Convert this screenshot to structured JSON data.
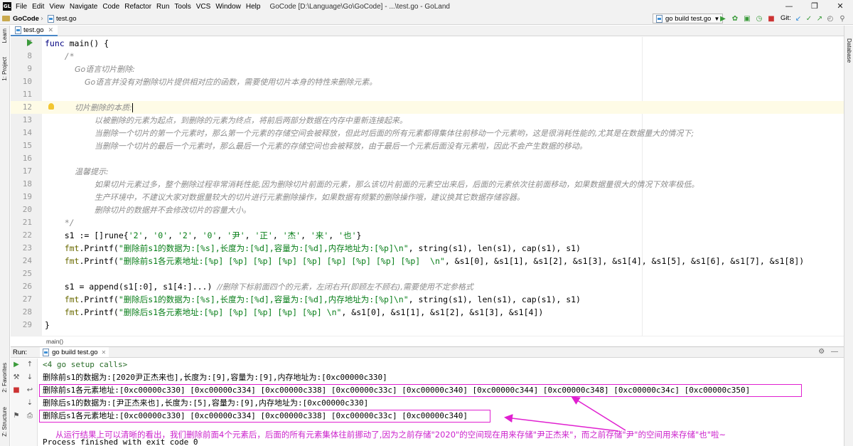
{
  "titlebar": {
    "menus": [
      "File",
      "Edit",
      "View",
      "Navigate",
      "Code",
      "Refactor",
      "Run",
      "Tools",
      "VCS",
      "Window",
      "Help"
    ],
    "window_title": "GoCode [D:\\Language\\Go\\GoCode] - ...\\test.go - GoLand",
    "logo": "GL"
  },
  "navbar": {
    "project": "GoCode",
    "file": "test.go",
    "run_config": "go build test.go",
    "git_label": "Git:"
  },
  "left_tabs": [
    "1: Project",
    "Learn",
    "2: Favorites",
    "Z: Structure"
  ],
  "right_tabs": [
    "Database"
  ],
  "editor": {
    "tab_label": "test.go",
    "lines": [
      {
        "n": "7",
        "segments": [
          {
            "t": "kw",
            "v": "func"
          },
          {
            "t": "plain",
            "v": " main() {"
          }
        ]
      },
      {
        "n": "8",
        "segments": [
          {
            "t": "cmt-mono",
            "v": "    /*"
          }
        ]
      },
      {
        "n": "9",
        "segments": [
          {
            "t": "comment",
            "v": "            Go语言切片删除:"
          }
        ]
      },
      {
        "n": "10",
        "segments": [
          {
            "t": "comment",
            "v": "                Go语言并没有对删除切片提供相对应的函数，需要使用切片本身的特性来删除元素。"
          }
        ]
      },
      {
        "n": "11",
        "segments": []
      },
      {
        "n": "12",
        "segments": [
          {
            "t": "comment",
            "v": "            切片删除的本质:"
          }
        ],
        "highlight": true,
        "caret": true
      },
      {
        "n": "13",
        "segments": [
          {
            "t": "comment",
            "v": "                    以被删除的元素为起点，到删除的元素为终点，将前后两部分数据在内存中重新连接起来。"
          }
        ]
      },
      {
        "n": "14",
        "segments": [
          {
            "t": "comment",
            "v": "                    当删除一个切片的第一个元素时，那么第一个元素的存储空间会被释放，但此时后面的所有元素都得集体往前移动一个元素哟，这是很消耗性能的,尤其是在数据量大的情况下;"
          }
        ]
      },
      {
        "n": "15",
        "segments": [
          {
            "t": "comment",
            "v": "                    当删除一个切片的最后一个元素时，那么最后一个元素的存储空间也会被释放，由于最后一个元素后面没有元素啦，因此不会产生数据的移动。"
          }
        ]
      },
      {
        "n": "16",
        "segments": []
      },
      {
        "n": "17",
        "segments": [
          {
            "t": "comment",
            "v": "            温馨提示:"
          }
        ]
      },
      {
        "n": "18",
        "segments": [
          {
            "t": "comment",
            "v": "                    如果切片元素过多，整个删除过程非常消耗性能,因为删除切片前面的元素，那么该切片前面的元素空出来后，后面的元素依次往前面移动，如果数据量很大的情况下效率极低。"
          }
        ]
      },
      {
        "n": "19",
        "segments": [
          {
            "t": "comment",
            "v": "                    生产环境中，不建议大家对数据量较大的切片进行元素删除操作，如果数据有频繁的删除操作哦，建议换其它数据存储容器。"
          }
        ]
      },
      {
        "n": "20",
        "segments": [
          {
            "t": "comment",
            "v": "                    删除切片的数据并不会修改切片的容量大小。"
          }
        ]
      },
      {
        "n": "21",
        "segments": [
          {
            "t": "cmt-mono",
            "v": "    */"
          }
        ]
      },
      {
        "n": "22",
        "segments": [
          {
            "t": "plain",
            "v": "    s1 := []rune{"
          },
          {
            "t": "lit",
            "v": "'2'"
          },
          {
            "t": "plain",
            "v": ", "
          },
          {
            "t": "lit",
            "v": "'0'"
          },
          {
            "t": "plain",
            "v": ", "
          },
          {
            "t": "lit",
            "v": "'2'"
          },
          {
            "t": "plain",
            "v": ", "
          },
          {
            "t": "lit",
            "v": "'0'"
          },
          {
            "t": "plain",
            "v": ", "
          },
          {
            "t": "lit",
            "v": "'尹'"
          },
          {
            "t": "plain",
            "v": ", "
          },
          {
            "t": "lit",
            "v": "'正'"
          },
          {
            "t": "plain",
            "v": ", "
          },
          {
            "t": "lit",
            "v": "'杰'"
          },
          {
            "t": "plain",
            "v": ", "
          },
          {
            "t": "lit",
            "v": "'来'"
          },
          {
            "t": "plain",
            "v": ", "
          },
          {
            "t": "lit",
            "v": "'也'"
          },
          {
            "t": "plain",
            "v": "}"
          }
        ]
      },
      {
        "n": "23",
        "segments": [
          {
            "t": "pkg",
            "v": "    fmt"
          },
          {
            "t": "plain",
            "v": ".Printf("
          },
          {
            "t": "str",
            "v": "\"删除前s1的数据为:[%s],长度为:[%d],容量为:[%d],内存地址为:[%p]\\n\""
          },
          {
            "t": "plain",
            "v": ", string(s1), len(s1), cap(s1), s1)"
          }
        ]
      },
      {
        "n": "24",
        "segments": [
          {
            "t": "pkg",
            "v": "    fmt"
          },
          {
            "t": "plain",
            "v": ".Printf("
          },
          {
            "t": "str",
            "v": "\"删除前s1各元素地址:[%p] [%p] [%p] [%p] [%p] [%p] [%p] [%p] [%p]  \\n\""
          },
          {
            "t": "plain",
            "v": ", &s1[0], &s1[1], &s1[2], &s1[3], &s1[4], &s1[5], &s1[6], &s1[7], &s1[8])"
          }
        ]
      },
      {
        "n": "25",
        "segments": []
      },
      {
        "n": "26",
        "segments": [
          {
            "t": "plain",
            "v": "    s1 = append(s1[:0], s1[4:]...) "
          },
          {
            "t": "comment",
            "v": "//删除下标前面四个的元素，左闭右开(即顾左不顾右),需要使用不定参格式"
          }
        ]
      },
      {
        "n": "27",
        "segments": [
          {
            "t": "pkg",
            "v": "    fmt"
          },
          {
            "t": "plain",
            "v": ".Printf("
          },
          {
            "t": "str",
            "v": "\"删除后s1的数据为:[%s],长度为:[%d],容量为:[%d],内存地址为:[%p]\\n\""
          },
          {
            "t": "plain",
            "v": ", string(s1), len(s1), cap(s1), s1)"
          }
        ]
      },
      {
        "n": "28",
        "segments": [
          {
            "t": "pkg",
            "v": "    fmt"
          },
          {
            "t": "plain",
            "v": ".Printf("
          },
          {
            "t": "str",
            "v": "\"删除后s1各元素地址:[%p] [%p] [%p] [%p] [%p] \\n\""
          },
          {
            "t": "plain",
            "v": ", &s1[0], &s1[1], &s1[2], &s1[3], &s1[4])"
          }
        ]
      },
      {
        "n": "29",
        "segments": [
          {
            "t": "plain",
            "v": "}"
          }
        ]
      }
    ],
    "breadcrumb": "main()"
  },
  "run_panel": {
    "label": "Run:",
    "tab": "go build test.go",
    "console": [
      {
        "v": "<4 go setup calls>",
        "meta": true
      },
      {
        "v": "删除前s1的数据为:[2020尹正杰来也],长度为:[9],容量为:[9],内存地址为:[0xc00000c330]"
      },
      {
        "v": "删除前s1各元素地址:[0xc00000c330] [0xc00000c334] [0xc00000c338] [0xc00000c33c] [0xc00000c340] [0xc00000c344] [0xc00000c348] [0xc00000c34c] [0xc00000c350]"
      },
      {
        "v": "删除后s1的数据为:[尹正杰来也],长度为:[5],容量为:[9],内存地址为:[0xc00000c330]"
      },
      {
        "v": "删除后s1各元素地址:[0xc00000c330] [0xc00000c334] [0xc00000c338] [0xc00000c33c] [0xc00000c340]"
      }
    ],
    "exit_text": "Process finished with exit code 0",
    "annotation": "从运行结果上可以清晰的看出，我们删除前面4个元素后，后面的所有元素集体往前挪动了,因为之前存储\"2020\"的空间现在用来存储\"尹正杰来\"，而之前存储\"尹\"的空间用来存储\"也\"啦~"
  },
  "colors": {
    "annotation": "#cc22cc",
    "highlight_box": "#e020d0",
    "string": "#067d17",
    "keyword": "#000080",
    "comment": "#8c8c8c"
  }
}
